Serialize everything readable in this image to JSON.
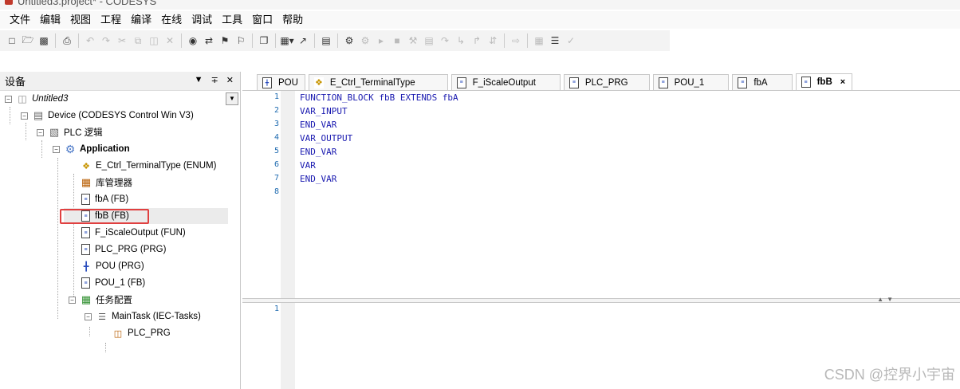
{
  "window": {
    "title": "Untitled3.project* - CODESYS"
  },
  "menu": [
    "文件",
    "编辑",
    "视图",
    "工程",
    "编译",
    "在线",
    "调试",
    "工具",
    "窗口",
    "帮助"
  ],
  "toolbar_icons": [
    "new-icon",
    "open-icon",
    "save-icon",
    "print-icon",
    "undo-icon",
    "redo-icon",
    "cut-icon",
    "copy-icon",
    "paste-icon",
    "delete-icon",
    "find-icon",
    "replace-icon",
    "bookmark-icon",
    "bookmark-next-icon",
    "window-icon",
    "view-dropdown-icon",
    "export-icon",
    "build-icon",
    "login-icon",
    "logout-icon",
    "run-icon",
    "stop-icon",
    "reset-icon",
    "breakpoint-icon",
    "step-over-icon",
    "step-into-icon",
    "step-out-icon",
    "next-statement-icon",
    "write-icon",
    "force-icon",
    "release-icon",
    "checkmark-icon"
  ],
  "left_panel": {
    "title": "设备",
    "tree": [
      {
        "label": "Untitled3",
        "italic": true
      },
      {
        "label": "Device (CODESYS Control Win V3)"
      },
      {
        "label": "PLC 逻辑"
      },
      {
        "label": "Application",
        "bold": true
      },
      {
        "label": "E_Ctrl_TerminalType (ENUM)"
      },
      {
        "label": "库管理器"
      },
      {
        "label": "fbA (FB)"
      },
      {
        "label": "fbB (FB)",
        "selected": true
      },
      {
        "label": "F_iScaleOutput (FUN)"
      },
      {
        "label": "PLC_PRG (PRG)"
      },
      {
        "label": "POU (PRG)"
      },
      {
        "label": "POU_1 (FB)"
      },
      {
        "label": "任务配置"
      },
      {
        "label": "MainTask (IEC-Tasks)"
      },
      {
        "label": "PLC_PRG"
      }
    ]
  },
  "tabs": [
    {
      "label": "POU",
      "icon": "ld-icon"
    },
    {
      "label": "E_Ctrl_TerminalType",
      "icon": "enum-icon"
    },
    {
      "label": "F_iScaleOutput",
      "icon": "doc-icon"
    },
    {
      "label": "PLC_PRG",
      "icon": "doc-icon"
    },
    {
      "label": "POU_1",
      "icon": "doc-icon"
    },
    {
      "label": "fbA",
      "icon": "doc-icon"
    },
    {
      "label": "fbB",
      "icon": "doc-icon",
      "active": true,
      "close": "×"
    }
  ],
  "editor": {
    "line_numbers": [
      "1",
      "2",
      "3",
      "4",
      "5",
      "6",
      "7",
      "8"
    ],
    "code": [
      "FUNCTION_BLOCK fbB EXTENDS fbA",
      "VAR_INPUT",
      "END_VAR",
      "VAR_OUTPUT",
      "END_VAR",
      "VAR",
      "END_VAR",
      ""
    ],
    "bottom_line_numbers": [
      "1"
    ]
  },
  "watermark": "CSDN @控界小宇宙",
  "colors": {
    "keyword": "#1a1ab0",
    "line_number": "#1f6bb0",
    "highlight": "#e04040"
  }
}
